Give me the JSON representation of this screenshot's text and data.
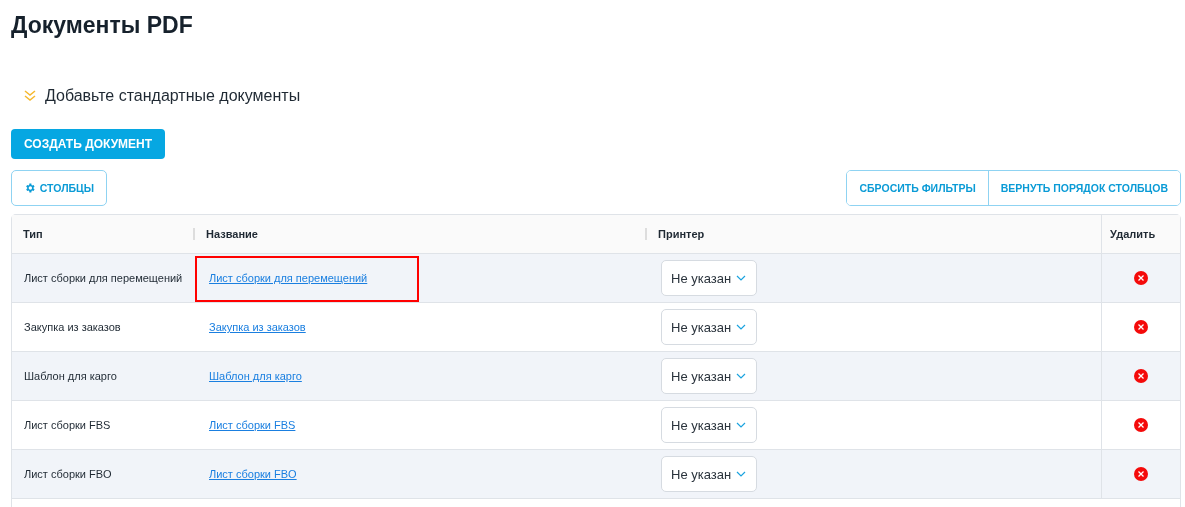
{
  "page_title": "Документы PDF",
  "collapsible": {
    "label": "Добавьте стандартные документы",
    "expanded": false
  },
  "create_button": "СОЗДАТЬ ДОКУМЕНТ",
  "columns_button": "СТОЛБЦЫ",
  "toolbar_buttons": [
    "СБРОСИТЬ ФИЛЬТРЫ",
    "ВЕРНУТЬ ПОРЯДОК СТОЛБЦОВ"
  ],
  "table": {
    "columns": [
      "Тип",
      "Название",
      "Принтер",
      "Удалить"
    ],
    "rows": [
      {
        "type": "Лист сборки для перемещений",
        "name": "Лист сборки для перемещений",
        "printer": "Не указан",
        "highlighted": true
      },
      {
        "type": "Закупка из заказов",
        "name": "Закупка из заказов",
        "printer": "Не указан",
        "highlighted": false
      },
      {
        "type": "Шаблон для карго",
        "name": "Шаблон для карго",
        "printer": "Не указан",
        "highlighted": false
      },
      {
        "type": "Лист сборки FBS",
        "name": "Лист сборки FBS",
        "printer": "Не указан",
        "highlighted": false
      },
      {
        "type": "Лист сборки FBO",
        "name": "Лист сборки FBO",
        "printer": "Не указан",
        "highlighted": false
      }
    ]
  }
}
